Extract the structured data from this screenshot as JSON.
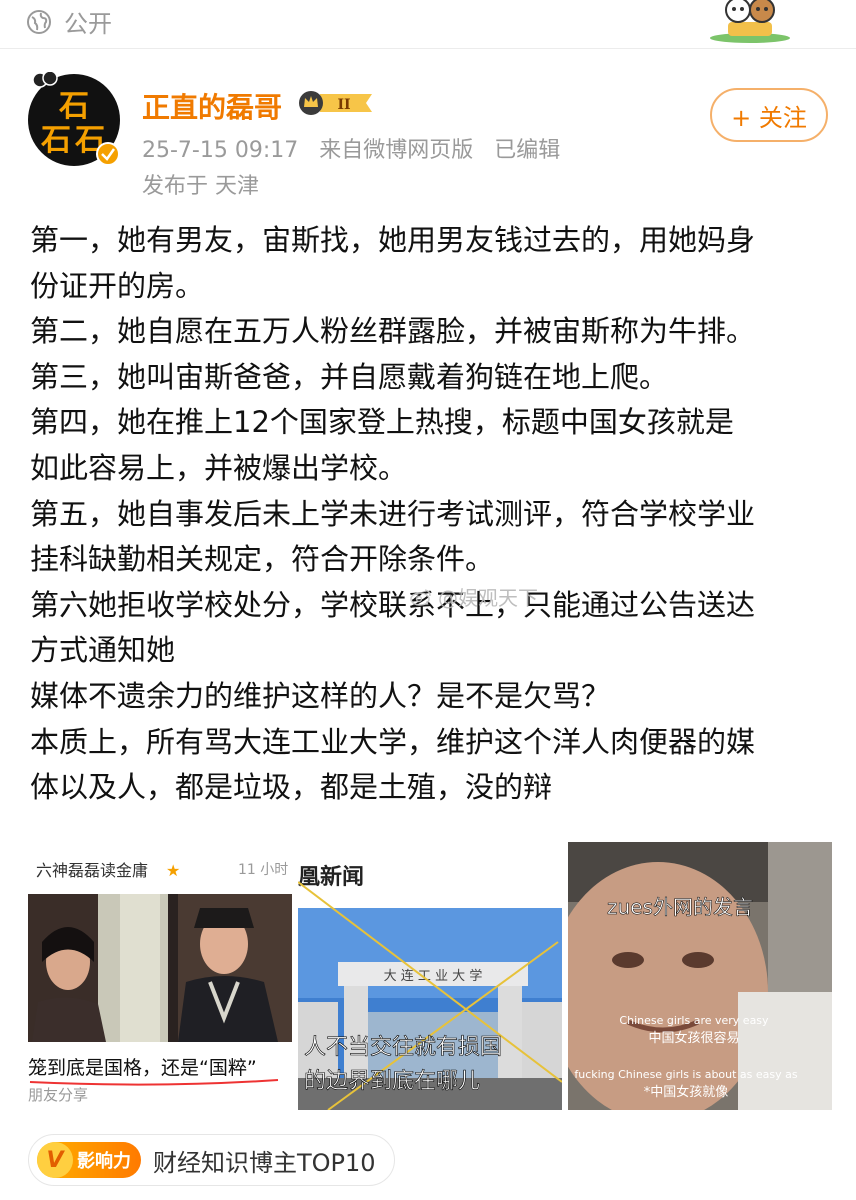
{
  "header": {
    "privacy_label": "公开",
    "privacy_icon": "globe-icon",
    "mascot_icon": "panda-mascot-icon"
  },
  "author": {
    "name": "正直的磊哥",
    "avatar_text": "石石石",
    "badge_label": "II",
    "verified_icon": "verified-check-icon"
  },
  "meta": {
    "time": "25-7-15 09:17",
    "source": "来自微博网页版",
    "edited": "已编辑",
    "location": "发布于 天津"
  },
  "follow_button": "+ 关注",
  "post": {
    "lines": [
      "第一，她有男友，宙斯找，她用男友钱过去的，用她妈身",
      "份证开的房。",
      "第二，她自愿在五万人粉丝群露脸，并被宙斯称为牛排。",
      "第三，她叫宙斯爸爸，并自愿戴着狗链在地上爬。",
      "第四，她在推上12个国家登上热搜，标题中国女孩就是",
      "如此容易上，并被爆出学校。",
      "第五，她自事发后未上学未进行考试测评，符合学校学业",
      "挂科缺勤相关规定，符合开除条件。",
      "第六她拒收学校处分，学校联系不上，只能通过公告送达",
      "方式通知她",
      "媒体不遗余力的维护这样的人？是不是欠骂？",
      "本质上，所有骂大连工业大学，维护这个洋人肉便器的媒",
      "体以及人，都是垃圾，都是土殖，没的辩"
    ]
  },
  "watermark": "@娱观天下",
  "images": {
    "img1": {
      "header_name": "六神磊磊读金庸",
      "header_time": "11 小时",
      "caption": "笼到底是国格，还是“国粹”",
      "footer": "朋友分享"
    },
    "img2": {
      "header": "凰新闻",
      "gate_text": "大 连 工 业 大 学",
      "caption_line1": "人不当交往就有损国",
      "caption_line2": "的边界到底在哪儿"
    },
    "img3": {
      "title": "zues外网的发言",
      "sub1_en": "Chinese girls are very easy",
      "sub1_zh": "中国女孩很容易",
      "sub2_en": "fucking Chinese girls is about as easy as",
      "sub2_zh": "*中国女孩就像"
    }
  },
  "influence": {
    "badge_v": "V",
    "badge_label": "影响力",
    "text": "财经知识博主TOP10"
  }
}
